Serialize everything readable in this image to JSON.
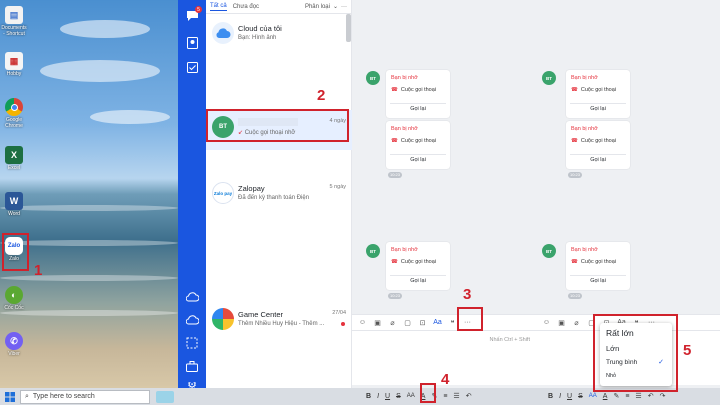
{
  "desktop": {
    "icons": [
      {
        "label": "Documents - Shortcut",
        "icon": "document-icon"
      },
      {
        "label": "Hobby",
        "icon": "grid-icon"
      },
      {
        "label": "Google Chrome",
        "icon": "chrome-icon"
      },
      {
        "label": "Excel",
        "icon": "excel-icon"
      },
      {
        "label": "Word",
        "icon": "word-icon"
      },
      {
        "label": "Zalo",
        "icon": "zalo-icon"
      },
      {
        "label": "Cốc Cốc",
        "icon": "coccoc-icon"
      },
      {
        "label": "Viber",
        "icon": "viber-icon"
      }
    ]
  },
  "taskbar": {
    "search_placeholder": "Type here to search"
  },
  "list": {
    "tabs": {
      "all": "Tất cả",
      "unread": "Chưa đọc",
      "classify": "Phân loại"
    },
    "items": [
      {
        "name": "Cloud của tôi",
        "sub": "Bạn: Hình ảnh",
        "time": "",
        "avatar_text": ""
      },
      {
        "name": "",
        "sub": "Cuộc gọi thoại nhỡ",
        "time": "4 ngày",
        "avatar_text": "BT"
      },
      {
        "name": "Zalopay",
        "sub": "Đã đến kỳ thanh toán Điện",
        "time": "5 ngày",
        "avatar_text": "Zalo pay"
      },
      {
        "name": "Game Center",
        "sub": "Thêm Nhiều Huy Hiệu - Thêm ...",
        "time": "27/04",
        "avatar_text": ""
      }
    ]
  },
  "chat": {
    "avatar_text": "BT",
    "missed_title": "Bạn bị nhỡ",
    "missed_sub": "Cuộc gọi thoại",
    "callback": "Gọi lại",
    "stamp": "10:23",
    "input_placeholder": "Nhấn Ctrl + Shift"
  },
  "dropdown": {
    "options": [
      "Rất lớn",
      "Lớn",
      "Trung bình",
      "Nhỏ"
    ],
    "selected": "Trung bình"
  },
  "steps": [
    "1",
    "2",
    "3",
    "4",
    "5"
  ],
  "colors": {
    "zalo_blue": "#1a56e0",
    "highlight": "#d0222c",
    "missed": "#e5323d"
  }
}
